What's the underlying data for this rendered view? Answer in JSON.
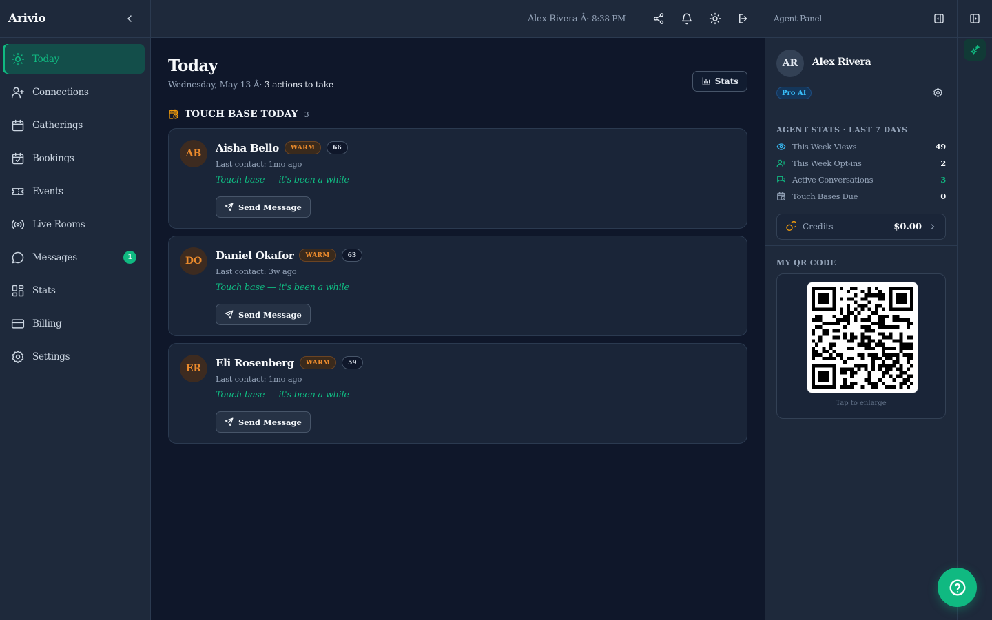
{
  "app": {
    "brand": "Arivio"
  },
  "sidebar": {
    "items": [
      {
        "label": "Today",
        "icon": "sun-icon"
      },
      {
        "label": "Connections",
        "icon": "user-plus-icon"
      },
      {
        "label": "Gatherings",
        "icon": "calendar-icon"
      },
      {
        "label": "Bookings",
        "icon": "calendar-check-icon"
      },
      {
        "label": "Events",
        "icon": "ticket-icon"
      },
      {
        "label": "Live Rooms",
        "icon": "broadcast-icon"
      },
      {
        "label": "Messages",
        "icon": "chat-bubble-icon",
        "badge": "1"
      },
      {
        "label": "Stats",
        "icon": "grid-icon"
      },
      {
        "label": "Billing",
        "icon": "credit-card-icon"
      },
      {
        "label": "Settings",
        "icon": "gear-icon"
      }
    ]
  },
  "topbar": {
    "user": "Alex Rivera",
    "separator": "Â·",
    "time": "8:38 PM"
  },
  "main": {
    "title": "Today",
    "date": "Wednesday, May 13",
    "separator": "Â·",
    "actions": "3 actions to take",
    "stats_label": "Stats",
    "section_title": "TOUCH BASE TODAY",
    "section_count": "3",
    "contacts": [
      {
        "initials": "AB",
        "name": "Aisha Bello",
        "status": "WARM",
        "score": "66",
        "last": "Last contact: 1mo ago",
        "hint": "Touch base — it's been a while",
        "action": "Send Message"
      },
      {
        "initials": "DO",
        "name": "Daniel Okafor",
        "status": "WARM",
        "score": "63",
        "last": "Last contact: 3w ago",
        "hint": "Touch base — it's been a while",
        "action": "Send Message"
      },
      {
        "initials": "ER",
        "name": "Eli Rosenberg",
        "status": "WARM",
        "score": "59",
        "last": "Last contact: 1mo ago",
        "hint": "Touch base — it's been a while",
        "action": "Send Message"
      }
    ]
  },
  "panel": {
    "title": "Agent Panel",
    "profile": {
      "initials": "AR",
      "name": "Alex Rivera",
      "plan": "Pro AI"
    },
    "stats_title": "AGENT STATS · LAST 7 DAYS",
    "stats": [
      {
        "label": "This Week Views",
        "value": "49",
        "color": "#38bdf8",
        "valueColor": "#f8fafc",
        "icon": "eye-icon"
      },
      {
        "label": "This Week Opt-ins",
        "value": "2",
        "color": "#10b981",
        "valueColor": "#f8fafc",
        "icon": "user-plus-icon"
      },
      {
        "label": "Active Conversations",
        "value": "3",
        "color": "#10b981",
        "valueColor": "#10b981",
        "icon": "chats-icon"
      },
      {
        "label": "Touch Bases Due",
        "value": "0",
        "color": "#94a3b8",
        "valueColor": "#f8fafc",
        "icon": "calendar-clock-icon"
      }
    ],
    "credits": {
      "label": "Credits",
      "amount": "$0.00"
    },
    "qr_title": "MY QR CODE",
    "qr_caption": "Tap to enlarge"
  },
  "colors": {
    "accent": "#10b981",
    "warm": "#ea8a2c",
    "bg": "#0f172a",
    "surface": "#1e293b"
  }
}
